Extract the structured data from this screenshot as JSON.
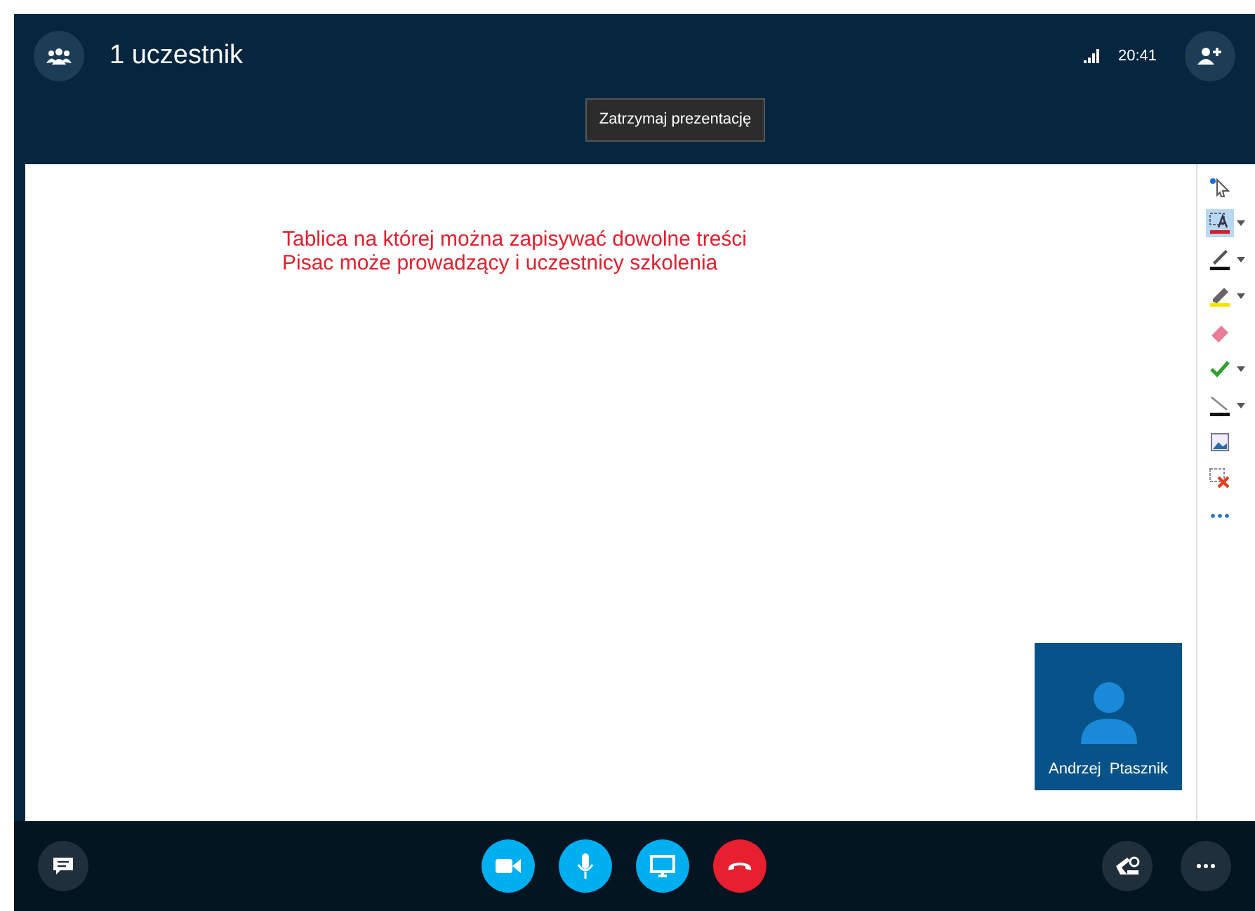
{
  "header": {
    "participants": "1 uczestnik",
    "time": "20:41"
  },
  "tooltip": "Zatrzymaj prezentację",
  "whiteboard": {
    "lines": [
      "Tablica na której można zapisywać dowolne treści",
      "Pisac może prowadzący i uczestnicy szkolenia"
    ]
  },
  "tools": [
    {
      "kind": "select",
      "selected": false,
      "dropdown": false
    },
    {
      "kind": "text",
      "selected": true,
      "dropdown": true
    },
    {
      "kind": "pen",
      "selected": false,
      "dropdown": true
    },
    {
      "kind": "highlighter",
      "selected": false,
      "dropdown": true
    },
    {
      "kind": "eraser",
      "selected": false,
      "dropdown": false
    },
    {
      "kind": "stamp",
      "selected": false,
      "dropdown": true
    },
    {
      "kind": "line",
      "selected": false,
      "dropdown": true
    },
    {
      "kind": "image",
      "selected": false,
      "dropdown": false
    },
    {
      "kind": "delete",
      "selected": false,
      "dropdown": false
    },
    {
      "kind": "more",
      "selected": false,
      "dropdown": false
    }
  ],
  "video_tile": {
    "name": "Andrzej  Ptasznik"
  }
}
